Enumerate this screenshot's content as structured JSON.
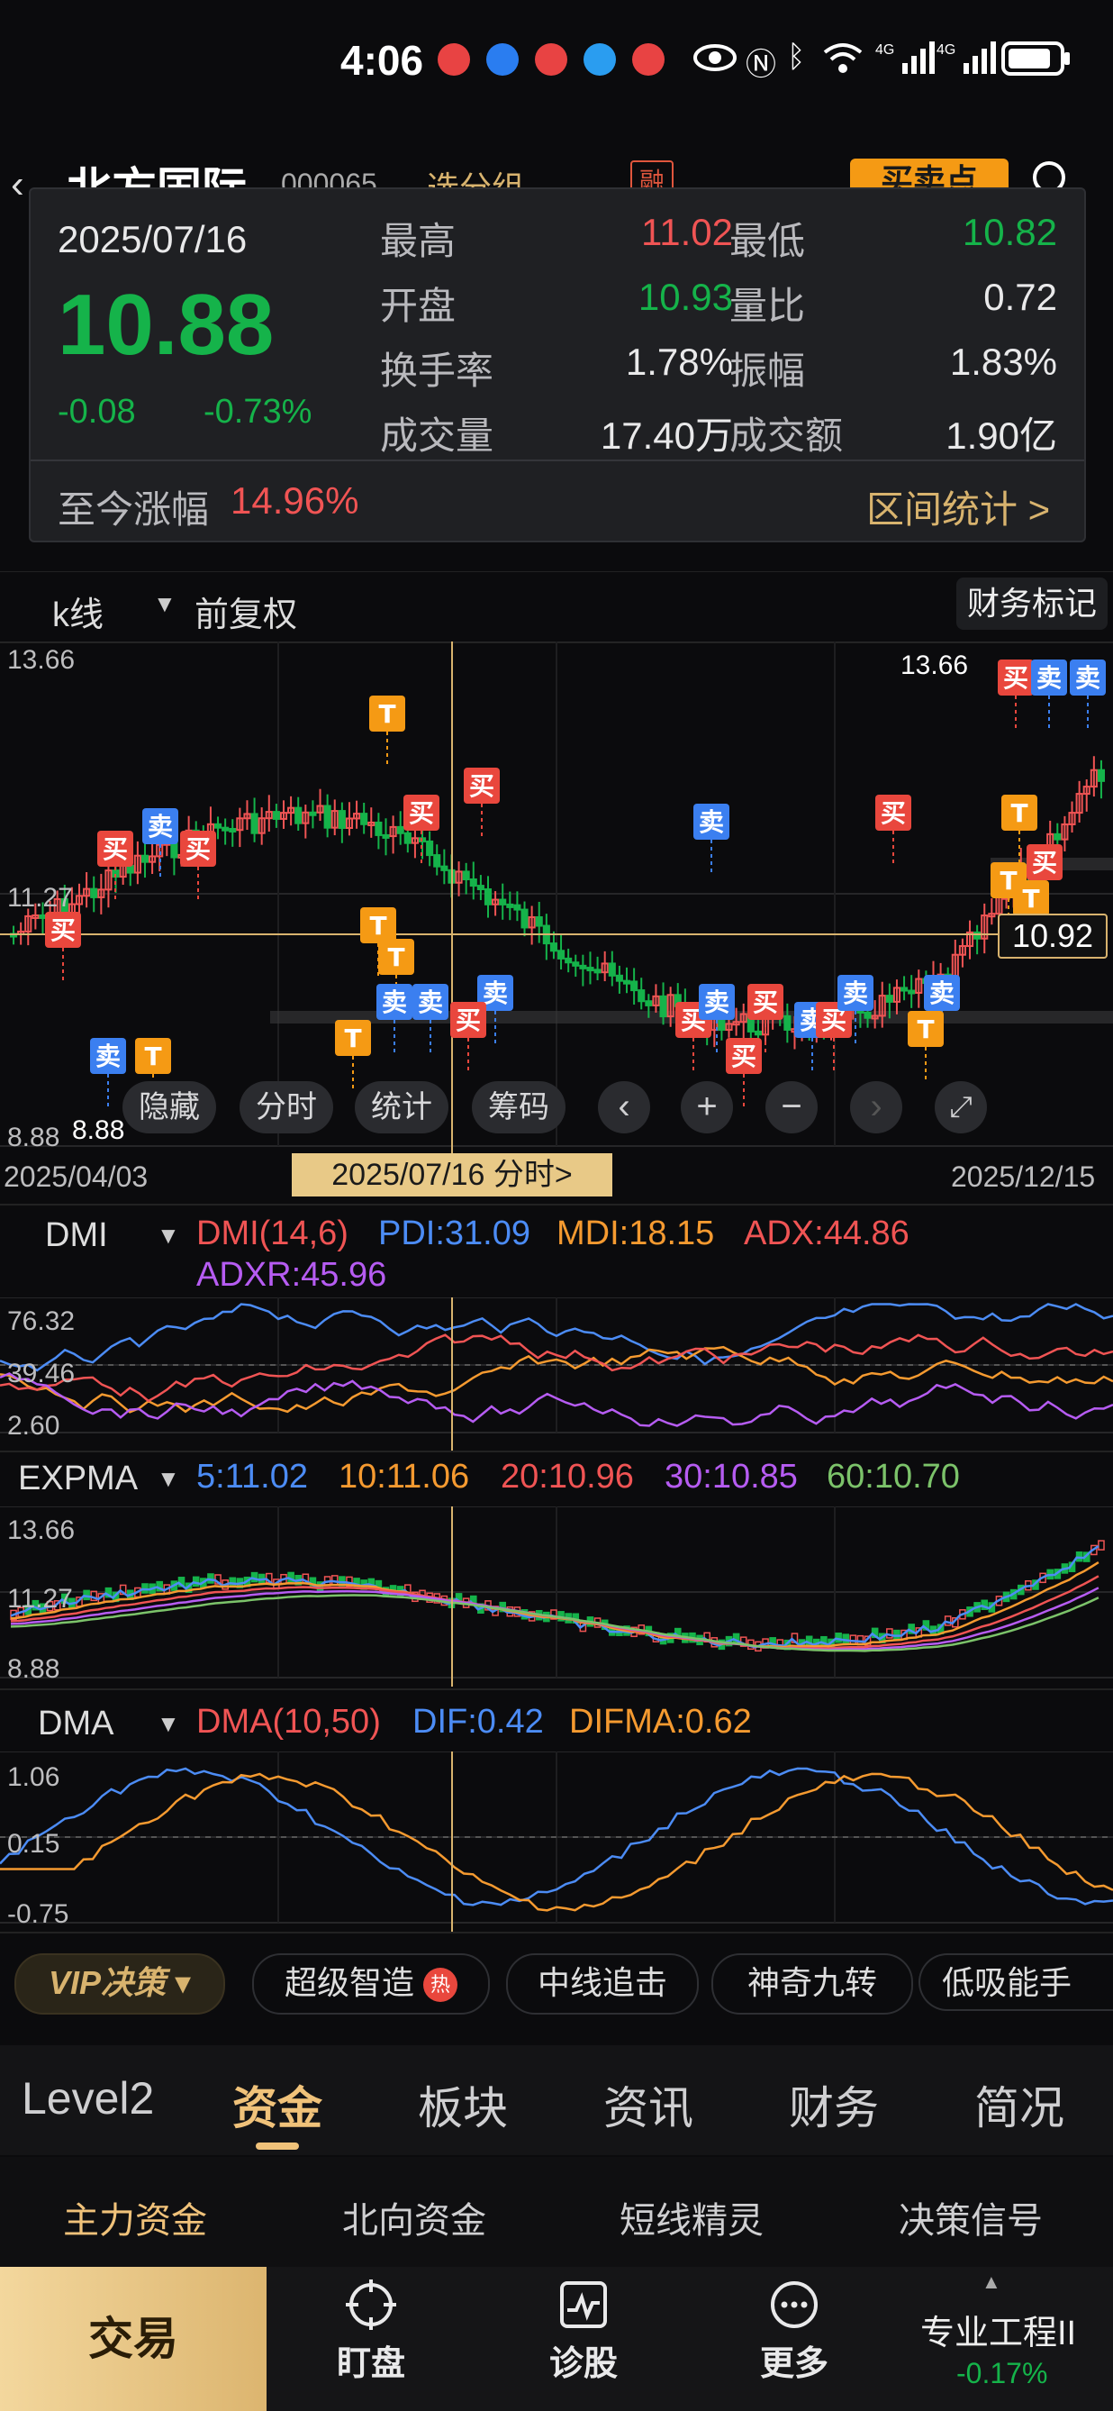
{
  "status_bar": {
    "time": "4:06"
  },
  "header": {
    "stock_name": "北方国际",
    "stock_code": "000065",
    "group_label": "选分组",
    "margin_badge": "融",
    "buy_sell_label": "买卖点"
  },
  "popup": {
    "date": "2025/07/16",
    "price": "10.88",
    "change": "-0.08",
    "change_pct": "-0.73%",
    "high_label": "最高",
    "high": "11.02",
    "low_label": "最低",
    "low": "10.82",
    "open_label": "开盘",
    "open": "10.93",
    "vol_ratio_label": "量比",
    "vol_ratio": "0.72",
    "turnover_label": "换手率",
    "turnover": "1.78%",
    "amplitude_label": "振幅",
    "amplitude": "1.83%",
    "volume_label": "成交量",
    "volume": "17.40万",
    "amount_label": "成交额",
    "amount": "1.90亿",
    "since_label": "至今涨幅",
    "since_value": "14.96%",
    "range_stats": "区间统计 >"
  },
  "kline": {
    "type_label": "k线",
    "adjust_label": "前复权",
    "finance_mark": "财务标记",
    "y_top": "13.66",
    "y_mid": "11.27",
    "y_bottom": "8.88",
    "high_marker": "13.66",
    "low_marker": "8.88",
    "cross_price": "10.92",
    "date_start": "2025/04/03",
    "date_end": "2025/12/15",
    "cross_date": "2025/07/16 分时>",
    "buy_tag": "买",
    "sell_tag": "卖",
    "t_tag": "T",
    "controls": {
      "hide": "隐藏",
      "timeshare": "分时",
      "stats": "统计",
      "chips": "筹码"
    }
  },
  "dmi": {
    "name": "DMI",
    "param": "DMI(14,6)",
    "pdi": "PDI:31.09",
    "mdi": "MDI:18.15",
    "adx": "ADX:44.86",
    "adxr": "ADXR:45.96",
    "y_top": "76.32",
    "y_mid": "39.46",
    "y_bottom": "2.60"
  },
  "expma": {
    "name": "EXPMA",
    "e5": "5:11.02",
    "e10": "10:11.06",
    "e20": "20:10.96",
    "e30": "30:10.85",
    "e60": "60:10.70",
    "y_top": "13.66",
    "y_mid": "11.27",
    "y_bottom": "8.88"
  },
  "dma": {
    "name": "DMA",
    "param": "DMA(10,50)",
    "dif": "DIF:0.42",
    "difma": "DIFMA:0.62",
    "y_top": "1.06",
    "y_mid": "0.15",
    "y_bottom": "-0.75"
  },
  "features": {
    "vip": "VIP决策",
    "items": [
      "超级智造",
      "中线追击",
      "神奇九转",
      "低吸能手"
    ],
    "hot_badge": "热"
  },
  "tabs": [
    "Level2",
    "资金",
    "板块",
    "资讯",
    "财务",
    "简况"
  ],
  "subtabs": [
    "主力资金",
    "北向资金",
    "短线精灵",
    "决策信号"
  ],
  "bottom_nav": {
    "trade": "交易",
    "watch": "盯盘",
    "diagnose": "诊股",
    "more": "更多",
    "pro_name": "专业工程II",
    "pro_change": "-0.17%"
  },
  "colors": {
    "up": "#f05454",
    "down": "#15b34a",
    "accent": "#d8b36e",
    "pdi": "#4c8cf5",
    "mdi": "#f59a30",
    "adx": "#f05454",
    "adxr": "#b65cf2"
  }
}
